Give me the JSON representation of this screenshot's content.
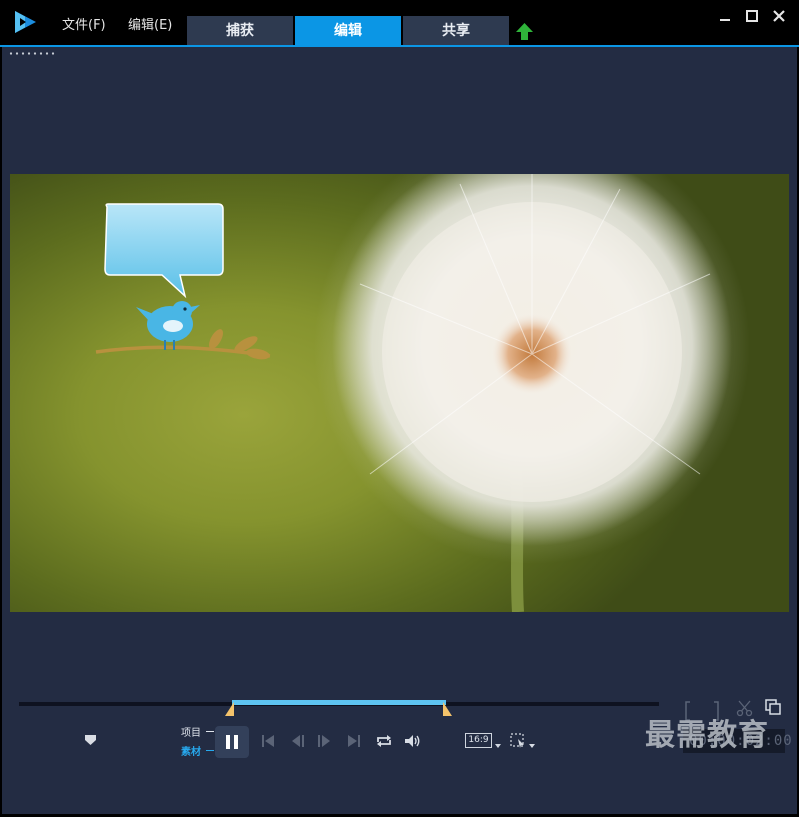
{
  "menu": {
    "file": "文件(F)",
    "edit": "编辑(E)"
  },
  "tabs": [
    {
      "label": "捕获"
    },
    {
      "label": "编辑",
      "active": true
    },
    {
      "label": "共享"
    }
  ],
  "icons": {
    "logo": "app-logo-icon",
    "upload": "upload-arrow-icon",
    "minimize": "minimize-icon",
    "maximize": "maximize-icon",
    "close": "close-icon",
    "scissors": "scissors-icon",
    "copy": "copy-icon",
    "snapshot": "snapshot-icon"
  },
  "colors": {
    "accent": "#0b96e5",
    "range": "#5ec4f2",
    "marker": "#f4c36b",
    "background": "#232c43"
  },
  "playback": {
    "mode_project": "项目",
    "mode_clip": "素材",
    "aspect_ratio": "16:9",
    "timecode": "00:00:02:00"
  },
  "watermark": "最需教育"
}
